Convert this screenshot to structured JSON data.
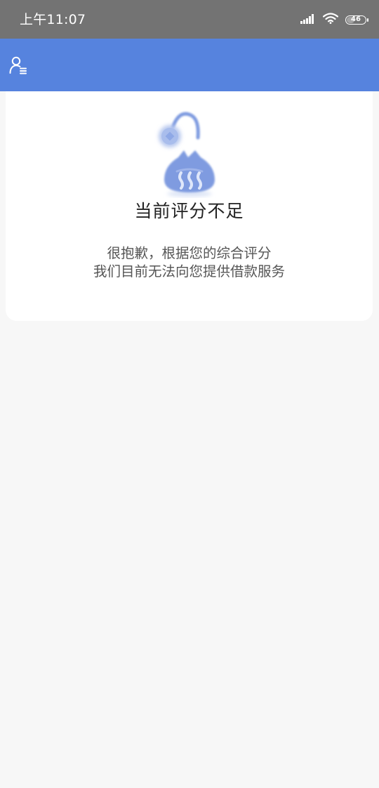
{
  "status_bar": {
    "time": "上午11:07",
    "battery_level": "46",
    "battery_fraction": 0.46,
    "icons": [
      "signal-icon",
      "wifi-icon",
      "battery-icon"
    ]
  },
  "app_bar": {
    "color": "#5683de",
    "left_icon": "user-menu-icon"
  },
  "result": {
    "illustration": "empty-money-bag-illustration",
    "title": "当前评分不足",
    "message_line1": "很抱歉，根据您的综合评分",
    "message_line2": "我们目前无法向您提供借款服务"
  },
  "colors": {
    "accent": "#5683de",
    "illustration": "#7f9be0",
    "background": "#f7f7f7"
  }
}
